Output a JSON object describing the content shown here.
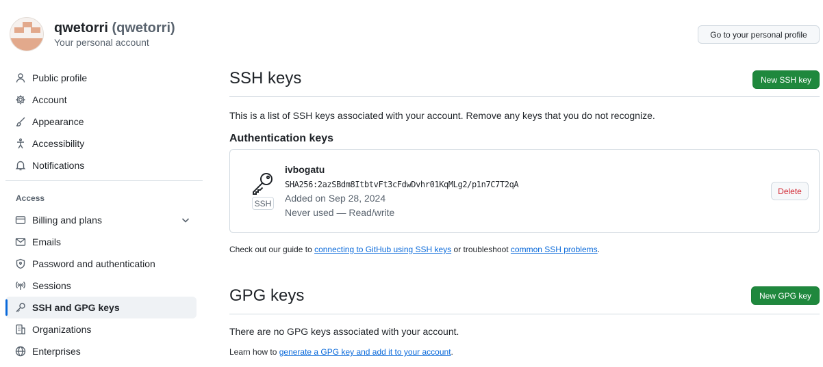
{
  "header": {
    "display_name": "qwetorri",
    "login": "(qwetorri)",
    "subtitle": "Your personal account",
    "profile_button": "Go to your personal profile"
  },
  "sidebar": {
    "items": [
      {
        "label": "Public profile",
        "icon": "person-icon"
      },
      {
        "label": "Account",
        "icon": "gear-icon"
      },
      {
        "label": "Appearance",
        "icon": "paintbrush-icon"
      },
      {
        "label": "Accessibility",
        "icon": "accessibility-icon"
      },
      {
        "label": "Notifications",
        "icon": "bell-icon"
      }
    ],
    "access_heading": "Access",
    "access_items": [
      {
        "label": "Billing and plans",
        "icon": "credit-card-icon"
      },
      {
        "label": "Emails",
        "icon": "mail-icon"
      },
      {
        "label": "Password and authentication",
        "icon": "shield-lock-icon"
      },
      {
        "label": "Sessions",
        "icon": "broadcast-icon"
      },
      {
        "label": "SSH and GPG keys",
        "icon": "key-icon",
        "active": true
      },
      {
        "label": "Organizations",
        "icon": "organization-icon"
      },
      {
        "label": "Enterprises",
        "icon": "globe-icon"
      }
    ]
  },
  "ssh": {
    "title": "SSH keys",
    "new_button": "New SSH key",
    "description": "This is a list of SSH keys associated with your account. Remove any keys that you do not recognize.",
    "auth_heading": "Authentication keys",
    "key": {
      "title": "ivbogatu",
      "fingerprint": "SHA256:2azSBdm8ItbtvFt3cFdwDvhr01KqMLg2/p1n7C7T2qA",
      "added": "Added on Sep 28, 2024",
      "usage": "Never used — Read/write",
      "badge": "SSH",
      "delete_button": "Delete"
    },
    "guide_prefix": "Check out our guide to ",
    "guide_link": "connecting to GitHub using SSH keys",
    "guide_middle": " or troubleshoot ",
    "guide_link2": "common SSH problems",
    "guide_suffix": "."
  },
  "gpg": {
    "title": "GPG keys",
    "new_button": "New GPG key",
    "description": "There are no GPG keys associated with your account.",
    "learn_prefix": "Learn how to ",
    "learn_link": "generate a GPG key and add it to your account",
    "learn_suffix": "."
  },
  "colors": {
    "accent": "#0969da",
    "primary_button": "#1f883d",
    "danger": "#d1242f"
  }
}
